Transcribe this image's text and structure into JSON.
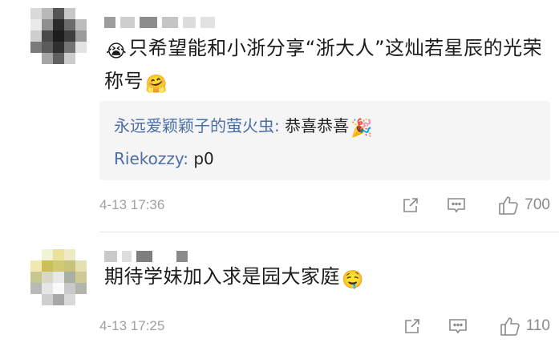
{
  "comments": [
    {
      "text_before_emoji": "只希望能和小浙分享“浙大人”这灿若星辰的光荣称号",
      "leading_emoji": "😭",
      "trailing_emoji": "🤗",
      "replies": [
        {
          "user": "永远爱颖颖子的萤火虫",
          "separator": ": ",
          "text": "恭喜恭喜",
          "emoji": "🎉"
        },
        {
          "user": "Riekozzy",
          "separator": ": ",
          "text": "p0"
        }
      ],
      "time": "4-13 17:36",
      "like_count": "700"
    },
    {
      "text": "期待学妹加入求是园大家庭",
      "trailing_emoji": "🤤",
      "time": "4-13 17:25",
      "like_count": "110"
    }
  ],
  "icons": {
    "share": "share-icon",
    "reply": "comment-icon",
    "like": "thumbs-up-icon"
  },
  "colors": {
    "reply_user": "#4a6ea5",
    "meta_text": "#a0a0a0",
    "reply_bg": "#f5f5f5"
  }
}
